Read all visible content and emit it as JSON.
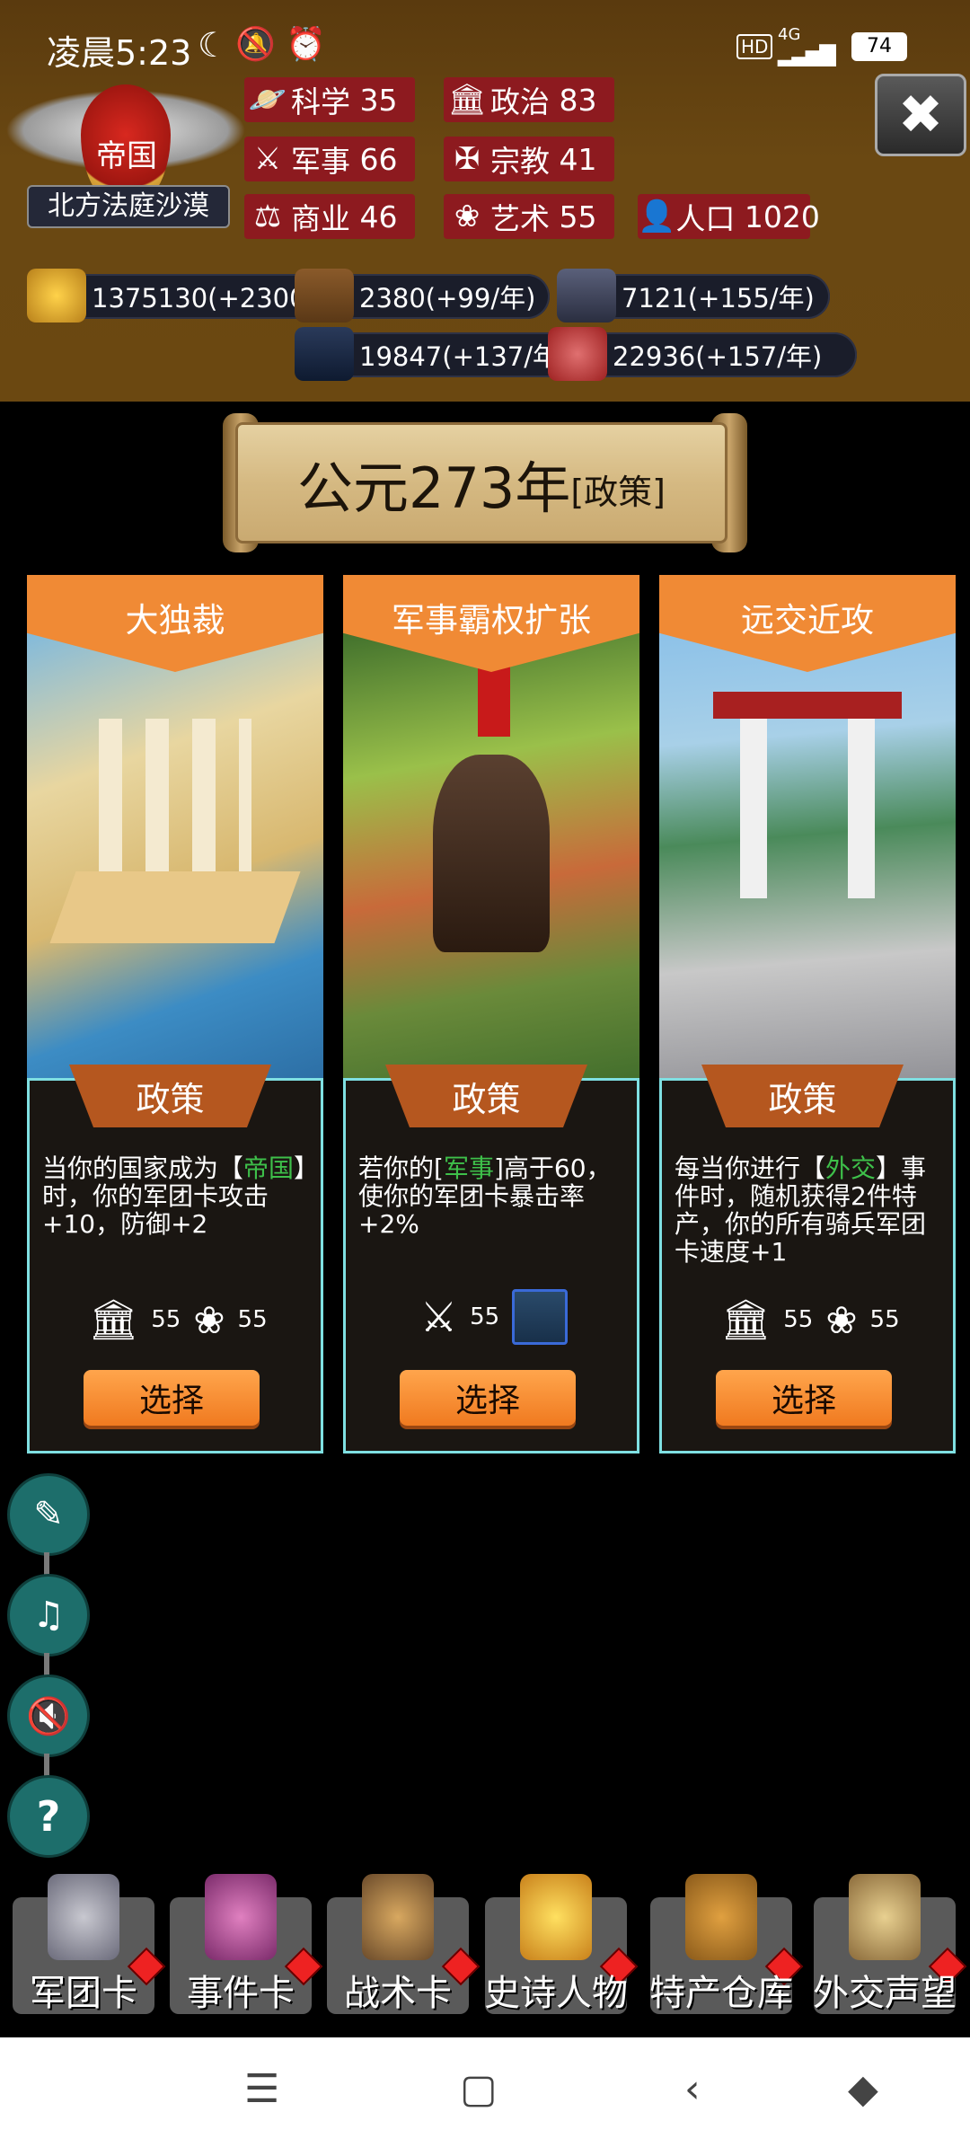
{
  "status_bar": {
    "time": "凌晨5:23",
    "network": "4G",
    "battery": "74"
  },
  "nation": {
    "emblem_title": "帝国",
    "name": "北方法庭沙漠"
  },
  "stats": [
    {
      "label": "科学",
      "value": "35"
    },
    {
      "label": "政治",
      "value": "83"
    },
    {
      "label": "军事",
      "value": "66"
    },
    {
      "label": "宗教",
      "value": "41"
    },
    {
      "label": "商业",
      "value": "46"
    },
    {
      "label": "艺术",
      "value": "55"
    },
    {
      "label": "人口",
      "value": "1020"
    }
  ],
  "resources": [
    {
      "name": "gold",
      "text": "1375130(+2300/年"
    },
    {
      "name": "wood",
      "text": "2380(+99/年)"
    },
    {
      "name": "ore",
      "text": "7121(+155/年)"
    },
    {
      "name": "tech",
      "text": "19847(+137/年)"
    },
    {
      "name": "meat",
      "text": "22936(+157/年)"
    }
  ],
  "banner": {
    "year": "公元273年",
    "tag": "[政策]"
  },
  "cards": [
    {
      "title": "大独裁",
      "type": "政策",
      "desc_parts": [
        "当你的国家成为【",
        "帝国",
        "】时，你的军团卡攻击+10，防御+2"
      ],
      "cost1": "55",
      "cost2": "55",
      "button": "选择"
    },
    {
      "title": "军事霸权扩张",
      "type": "政策",
      "desc_parts": [
        "若你的[",
        "军事",
        "]高于60，使你的军团卡暴击率+2%"
      ],
      "cost1": "55",
      "button": "选择"
    },
    {
      "title": "远交近攻",
      "type": "政策",
      "desc_parts": [
        "每当你进行【",
        "外交",
        "】事件时，随机获得2件特产，你的所有骑兵军团卡速度+1"
      ],
      "cost1": "55",
      "cost2": "55",
      "button": "选择"
    }
  ],
  "bottom_nav": [
    {
      "label": "军团卡"
    },
    {
      "label": "事件卡"
    },
    {
      "label": "战术卡"
    },
    {
      "label": "史诗人物"
    },
    {
      "label": "特产仓库"
    },
    {
      "label": "外交声望"
    }
  ],
  "colors": {
    "accent": "#f08a35",
    "stat_bg": "#8d1a1f",
    "card_border": "#7fe0e2",
    "highlight": "#3ec04a",
    "side_button": "#1d6e6b"
  }
}
